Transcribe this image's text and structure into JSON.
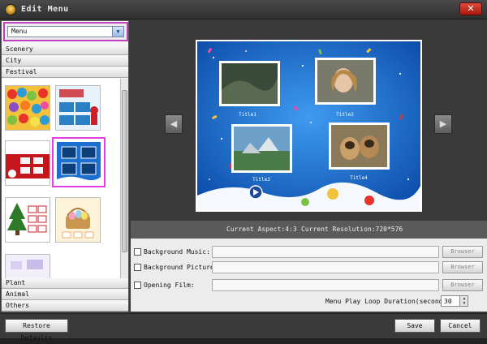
{
  "window": {
    "title": "Edit Menu",
    "close_glyph": "✕"
  },
  "menu_select": {
    "value": "Menu"
  },
  "categories_top": [
    "Scenery",
    "City",
    "Festival"
  ],
  "categories_bottom": [
    "Plant",
    "Animal",
    "Others"
  ],
  "preview": {
    "titles": [
      "Title1",
      "Title2",
      "Title3",
      "Title4"
    ],
    "prev_icon": "◀",
    "next_icon": "▶"
  },
  "info": {
    "aspect": "Current Aspect:4:3",
    "resolution": "Current Resolution:720*576"
  },
  "options": {
    "background_music": "Background Music:",
    "background_picture": "Background Picture:",
    "opening_film": "Opening Film:",
    "browse_label": "Browser",
    "loop_label": "Menu Play Loop Duration(seconds):",
    "loop_value": "30"
  },
  "footer": {
    "restore": "Restore Defaults",
    "save": "Save",
    "cancel": "Cancel"
  },
  "colors": {
    "accent_highlight": "#c040c0",
    "preview_sky": "#1a6fd1"
  }
}
